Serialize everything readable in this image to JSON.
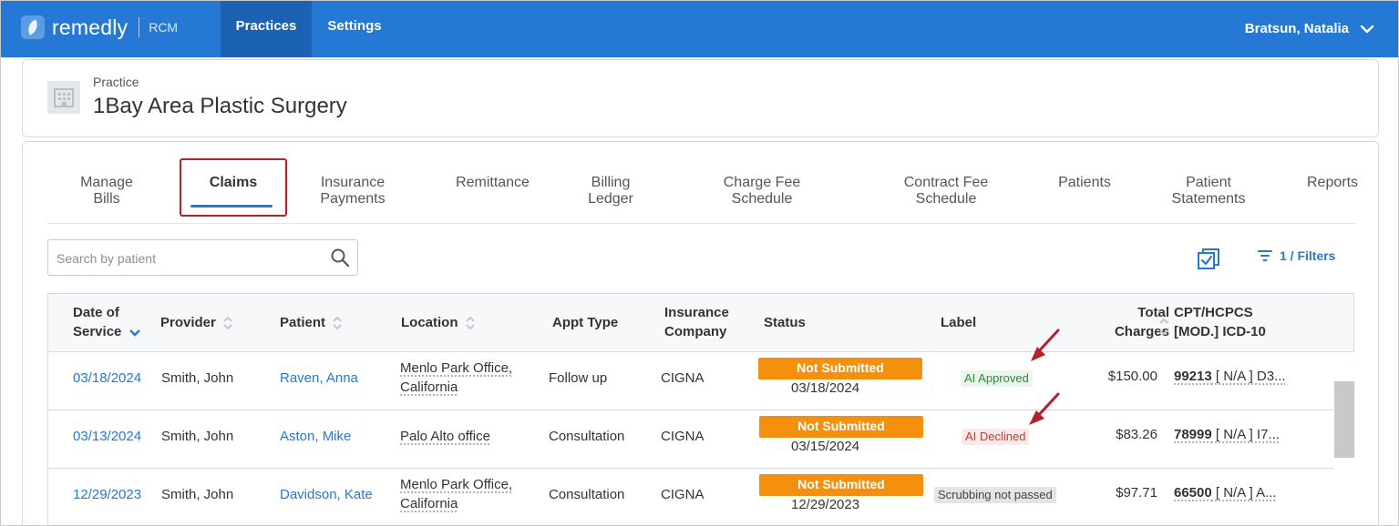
{
  "app": {
    "brand": "remedly",
    "product": "RCM"
  },
  "nav": {
    "items": [
      {
        "label": "Practices"
      },
      {
        "label": "Settings"
      }
    ],
    "user": "Bratsun, Natalia"
  },
  "practice": {
    "label": "Practice",
    "name": "1Bay Area Plastic Surgery"
  },
  "tabs": [
    {
      "line1": "Manage",
      "line2": "Bills"
    },
    {
      "line1": "Claims",
      "line2": ""
    },
    {
      "line1": "Insurance",
      "line2": "Payments"
    },
    {
      "line1": "Remittance",
      "line2": ""
    },
    {
      "line1": "Billing",
      "line2": "Ledger"
    },
    {
      "line1": "Charge Fee",
      "line2": "Schedule"
    },
    {
      "line1": "Contract Fee",
      "line2": "Schedule"
    },
    {
      "line1": "Patients",
      "line2": ""
    },
    {
      "line1": "Patient",
      "line2": "Statements"
    },
    {
      "line1": "Reports",
      "line2": ""
    }
  ],
  "search": {
    "placeholder": "Search by patient",
    "value": ""
  },
  "filters": {
    "label": "1 / Filters"
  },
  "columns": {
    "date_1": "Date of",
    "date_2": "Service",
    "provider": "Provider",
    "patient": "Patient",
    "location": "Location",
    "appt_type": "Appt Type",
    "ins_1": "Insurance",
    "ins_2": "Company",
    "status": "Status",
    "label": "Label",
    "charges_1": "Total",
    "charges_2": "Charges",
    "cpt_1": "CPT/HCPCS",
    "cpt_2": "[MOD.] ICD-10"
  },
  "rows": [
    {
      "date": "03/18/2024",
      "provider": "Smith, John",
      "patient": "Raven, Anna",
      "loc1": "Menlo Park Office,",
      "loc2": "California",
      "appt": "Follow up",
      "ins": "CIGNA",
      "status": "Not Submitted",
      "status_date": "03/18/2024",
      "label": "AI Approved",
      "charges": "$150.00",
      "cpt_code": "99213",
      "cpt_rest": " [ N/A ] D3..."
    },
    {
      "date": "03/13/2024",
      "provider": "Smith, John",
      "patient": "Aston, Mike",
      "loc1": "Palo Alto office",
      "loc2": "",
      "appt": "Consultation",
      "ins": "CIGNA",
      "status": "Not Submitted",
      "status_date": "03/15/2024",
      "label": "AI Declined",
      "charges": "$83.26",
      "cpt_code": "78999",
      "cpt_rest": " [ N/A ] I7..."
    },
    {
      "date": "12/29/2023",
      "provider": "Smith, John",
      "patient": "Davidson, Kate",
      "loc1": "Menlo Park Office,",
      "loc2": "California",
      "appt": "Consultation",
      "ins": "CIGNA",
      "status": "Not Submitted",
      "status_date": "12/29/2023",
      "label": "Scrubbing not passed",
      "charges": "$97.71",
      "cpt_code": "66500",
      "cpt_rest": " [ N/A ] A..."
    }
  ],
  "colors": {
    "primary": "#2578d4",
    "status_orange": "#f5900f",
    "highlight_red": "#b3222a"
  }
}
